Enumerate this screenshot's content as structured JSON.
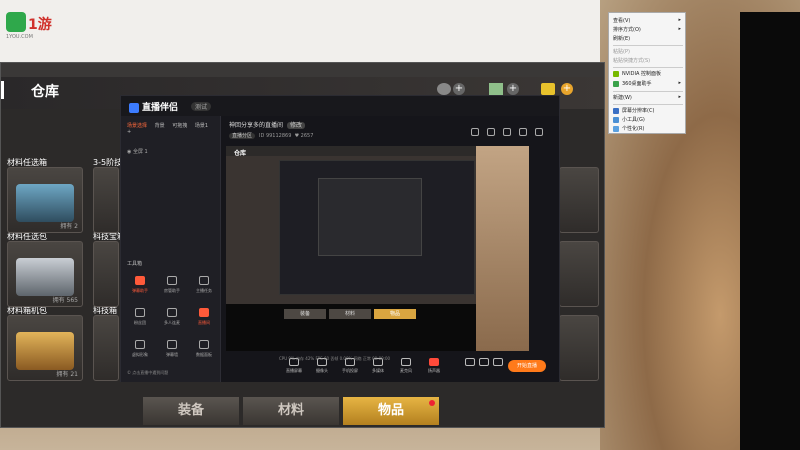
{
  "desktop": {
    "logo_text": "1游",
    "logo_sub": "1YOU.COM"
  },
  "game": {
    "title": "仓库",
    "categories": [
      {
        "label": "材料任选箱"
      },
      {
        "label": "3-5阶技"
      },
      {
        "label": "材料任选包"
      },
      {
        "label": "科技宝箱"
      },
      {
        "label": "材料箱机包"
      },
      {
        "label": "科技箱"
      }
    ],
    "owned_prefix": "拥有",
    "counts": [
      "2",
      "565",
      "21"
    ],
    "tabs": [
      {
        "label": "装备"
      },
      {
        "label": "材料"
      },
      {
        "label": "物品"
      }
    ]
  },
  "stream": {
    "app_name": "直播伴侣",
    "version": "测试",
    "left_tabs": [
      "场景选择",
      "背景",
      "可拖拽",
      "场景1"
    ],
    "scene_item": "全屏 1",
    "tools_label": "工具箱",
    "tools": [
      {
        "label": "弹幕助手",
        "red": true
      },
      {
        "label": "房管助手",
        "red": false
      },
      {
        "label": "主播任务",
        "red": false
      },
      {
        "label": "粉丝团",
        "red": false
      },
      {
        "label": "多人连麦",
        "red": false
      },
      {
        "label": "直播间",
        "red": true
      },
      {
        "label": "虚拟形象",
        "red": false
      },
      {
        "label": "弹幕墙",
        "red": false
      },
      {
        "label": "数据面板",
        "red": false
      }
    ],
    "help": "© 点击直播中遇到问题",
    "room_title": "神回分享多的直播间",
    "room_tag": "修改",
    "room_tag2": "直播分区",
    "room_id": "99112869",
    "room_fans": "2657",
    "preview_title": "仓库",
    "preview_tabs": [
      "装备",
      "材料",
      "物品"
    ],
    "controls": [
      {
        "label": "直播屏幕",
        "red": false
      },
      {
        "label": "摄像头",
        "red": false
      },
      {
        "label": "手机投屏",
        "red": false
      },
      {
        "label": "多媒体",
        "red": false
      },
      {
        "label": "麦克风",
        "red": false
      },
      {
        "label": "扬声器",
        "red": true
      }
    ],
    "go_live": "开始直播",
    "status": "CPU 9%    内存 42%    FPS 60    丢帧 0.00%    网络 正常    00:00:00"
  },
  "context_menu": {
    "items": [
      {
        "label": "查看(V)",
        "arrow": true,
        "disabled": false
      },
      {
        "label": "排序方式(O)",
        "arrow": true,
        "disabled": false
      },
      {
        "label": "刷新(E)",
        "arrow": false,
        "disabled": false
      },
      {
        "label": "粘贴(P)",
        "arrow": false,
        "disabled": true
      },
      {
        "label": "粘贴快捷方式(S)",
        "arrow": false,
        "disabled": true
      },
      {
        "label": "NVIDIA 控制面板",
        "arrow": false,
        "disabled": false
      },
      {
        "label": "360桌面助手",
        "arrow": true,
        "disabled": false
      },
      {
        "label": "新建(W)",
        "arrow": true,
        "disabled": false
      },
      {
        "label": "屏幕分辨率(C)",
        "arrow": false,
        "disabled": false
      },
      {
        "label": "小工具(G)",
        "arrow": false,
        "disabled": false
      },
      {
        "label": "个性化(R)",
        "arrow": false,
        "disabled": false
      }
    ]
  },
  "colors": {
    "accent": "#ff7a1a",
    "gold": "#d9a540",
    "red": "#ff4a3a"
  }
}
